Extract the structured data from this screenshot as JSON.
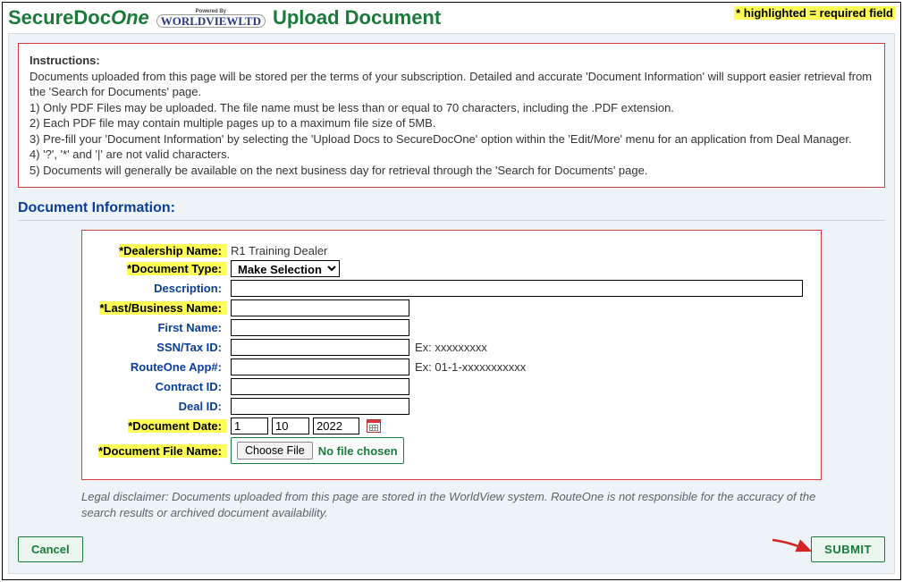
{
  "header": {
    "title_part1": "SecureDoc",
    "title_part2": "One",
    "title_part3": "Upload Document",
    "logo_powered": "Powered By",
    "logo_text": "WORLDVIEWLTD",
    "required_note": "* highlighted = required field"
  },
  "instructions": {
    "heading": "Instructions:",
    "body": "Documents uploaded from this page will be stored per the terms of your subscription. Detailed and accurate 'Document Information' will support easier retrieval from the 'Search for Documents' page.",
    "lines": [
      "1) Only PDF Files may be uploaded. The file name must be less than or equal to 70 characters, including the .PDF extension.",
      "2) Each PDF file may contain multiple pages up to a maximum file size of 5MB.",
      "3) Pre-fill your 'Document Information' by selecting the 'Upload Docs to SecureDocOne' option within the 'Edit/More' menu for an application from Deal Manager.",
      "4) '?', '*' and '|' are not valid characters.",
      "5) Documents will generally be available on the next business day for retrieval through the 'Search for Documents' page."
    ]
  },
  "section_title": "Document Information:",
  "labels": {
    "dealership": "*Dealership Name:",
    "doc_type": "*Document Type:",
    "description": "Description:",
    "last_name": "*Last/Business Name:",
    "first_name": "First Name:",
    "ssn": "SSN/Tax ID:",
    "routeone": "RouteOne App#:",
    "contract": "Contract ID:",
    "deal": "Deal ID:",
    "doc_date": "*Document Date:",
    "file_name": "*Document File Name:"
  },
  "values": {
    "dealership": "R1 Training Dealer",
    "doc_type_selected": "Make Selection",
    "description": "",
    "last_name": "",
    "first_name": "",
    "ssn": "",
    "routeone": "",
    "contract": "",
    "deal": "",
    "date_m": "1",
    "date_d": "10",
    "date_y": "2022",
    "file_status": "No file chosen"
  },
  "hints": {
    "ssn": "Ex: xxxxxxxxx",
    "routeone": "Ex: 01-1-xxxxxxxxxxx"
  },
  "buttons": {
    "choose_file": "Choose File",
    "cancel": "Cancel",
    "submit": "SUBMIT"
  },
  "disclaimer": "Legal disclaimer: Documents uploaded from this page are stored in the WorldView system. RouteOne is not responsible for the accuracy of the search results or archived document availability."
}
